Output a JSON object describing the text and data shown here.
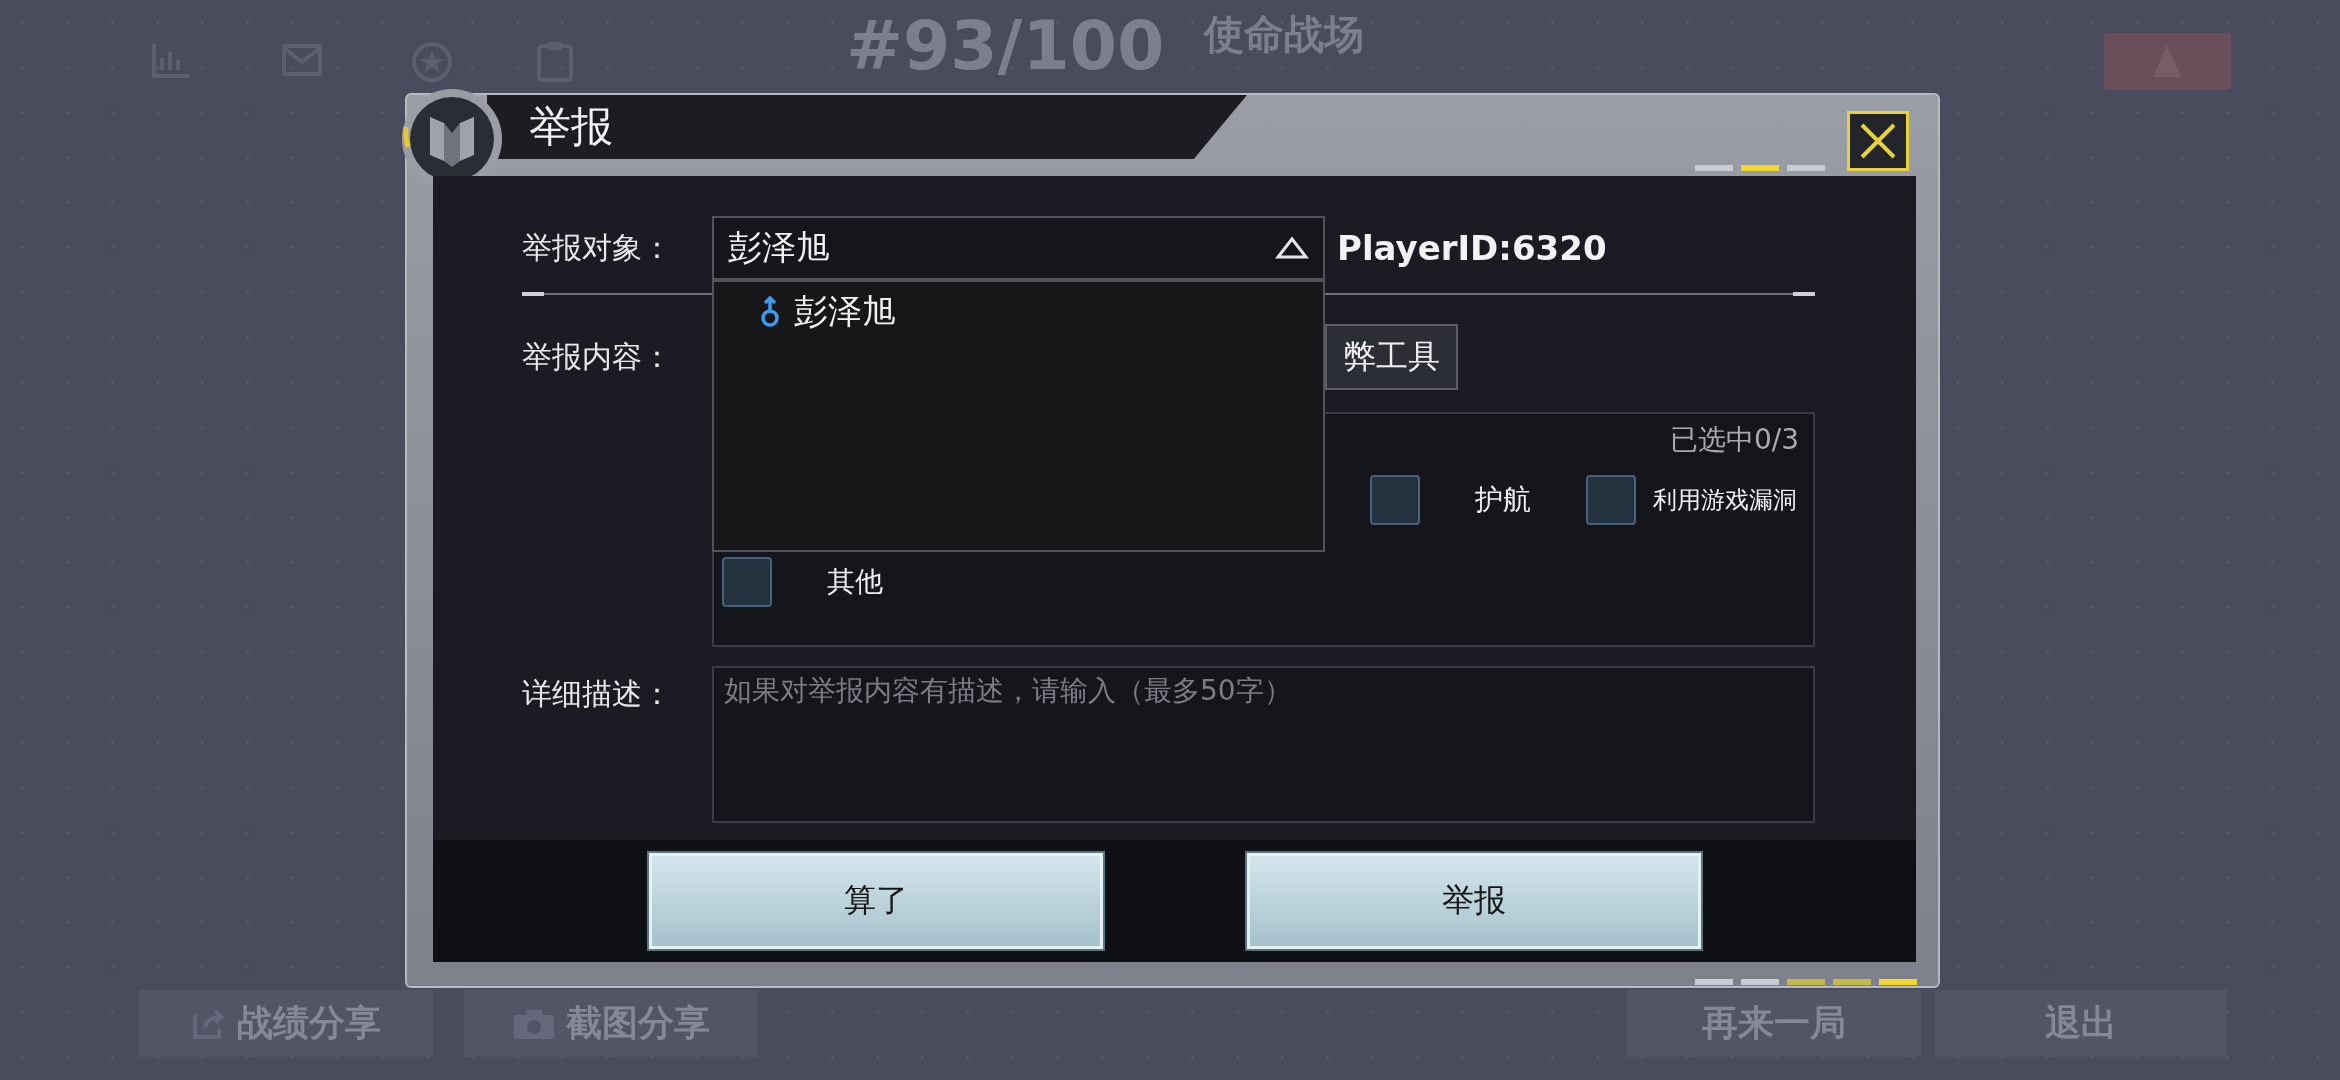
{
  "background": {
    "rank": "#93/100",
    "mode": "使命战场",
    "buttons": [
      {
        "label": "战绩分享",
        "kind": "share"
      },
      {
        "label": "截图分享",
        "kind": "screenshot"
      },
      {
        "label": "再来一局",
        "kind": "plain"
      },
      {
        "label": "退出",
        "kind": "plain"
      }
    ]
  },
  "dialog": {
    "title": "举报",
    "target": {
      "label": "举报对象：",
      "value": "彭泽旭",
      "expanded": true,
      "player_id": "PlayerID:6320",
      "options": [
        {
          "name": "彭泽旭"
        }
      ]
    },
    "content": {
      "label": "举报内容：",
      "tabs": [
        {
          "label": "弊工具",
          "selected": false
        }
      ],
      "count": "已选中0/3",
      "options": [
        {
          "label": "护航",
          "checked": false
        },
        {
          "label": "利用游戏漏洞",
          "checked": false
        },
        {
          "label": "其他",
          "checked": false
        }
      ]
    },
    "description": {
      "label": "详细描述：",
      "placeholder": "如果对举报内容有描述，请输入（最多50字）"
    },
    "buttons": [
      "算了",
      "举报"
    ]
  }
}
